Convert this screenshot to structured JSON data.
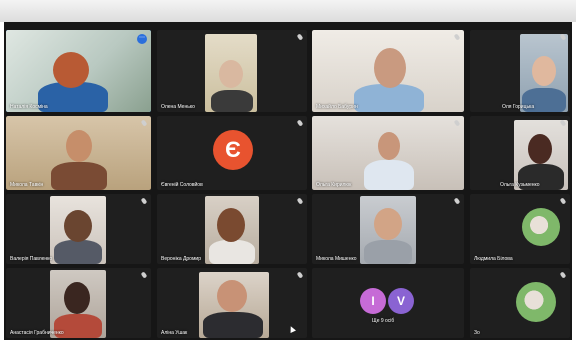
{
  "meeting": {
    "participants": [
      {
        "name": "Наталія Косміна"
      },
      {
        "name": "Олена Менько"
      },
      {
        "name": "Михайло Бабурин"
      },
      {
        "name": "Оля Горицька"
      },
      {
        "name": "Микола Тавкін"
      },
      {
        "name": "Євгеній Соловйов",
        "avatar_letter": "Є"
      },
      {
        "name": "Ольга Кирилюк"
      },
      {
        "name": "Ольга Кузьменко"
      },
      {
        "name": "Валерія Павленко"
      },
      {
        "name": "Вероніка Дромир"
      },
      {
        "name": "Микола Мишенко"
      },
      {
        "name": "Людмила Білова"
      },
      {
        "name": "Анастасія Грабниченко"
      },
      {
        "name": "Аліна Ушак"
      },
      {
        "more_avatar_1": "I",
        "more_avatar_2": "V",
        "more_label": "Ще 9 осіб"
      },
      {
        "name": "Зо"
      }
    ]
  },
  "colors": {
    "accent": "#3aa0ff",
    "tile_bg": "#1f1f1f",
    "screen_bg": "#161616",
    "avatar_e": "#e8532f",
    "avatar_i": "#c66bd6",
    "avatar_v": "#8a63d2"
  }
}
